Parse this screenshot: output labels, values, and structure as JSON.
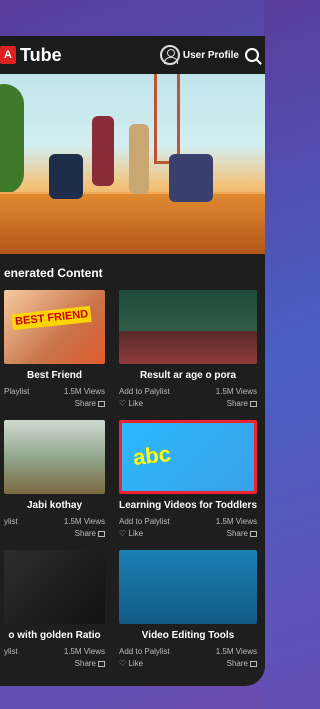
{
  "app": {
    "logo_letter": "A",
    "title": "Tube"
  },
  "header": {
    "profile_label": "User Profile"
  },
  "section": {
    "title": "enerated Content"
  },
  "cards": [
    {
      "title": "Best Friend",
      "badge": "BEST FRIEND",
      "left1": "Playlist",
      "views": "1.5M Views",
      "left2": "",
      "share": "Share"
    },
    {
      "title": "Result ar age o pora",
      "badge": "",
      "left1": "Add to Palylist",
      "views": "1.5M Views",
      "left2": "Like",
      "share": "Share"
    },
    {
      "title": "Jabi kothay",
      "badge": "",
      "left1": "ylist",
      "views": "1.5M Views",
      "left2": "",
      "share": "Share"
    },
    {
      "title": "Learning Videos for Toddlers",
      "badge": "abc",
      "left1": "Add to Palylist",
      "views": "1.5M Views",
      "left2": "Like",
      "share": "Share"
    },
    {
      "title": "o with golden Ratio",
      "badge": "",
      "left1": "ylist",
      "views": "1.5M Views",
      "left2": "",
      "share": "Share"
    },
    {
      "title": "Video Editing Tools",
      "badge": "",
      "left1": "Add to Palylist",
      "views": "1.5M Views",
      "left2": "Like",
      "share": "Share"
    }
  ]
}
